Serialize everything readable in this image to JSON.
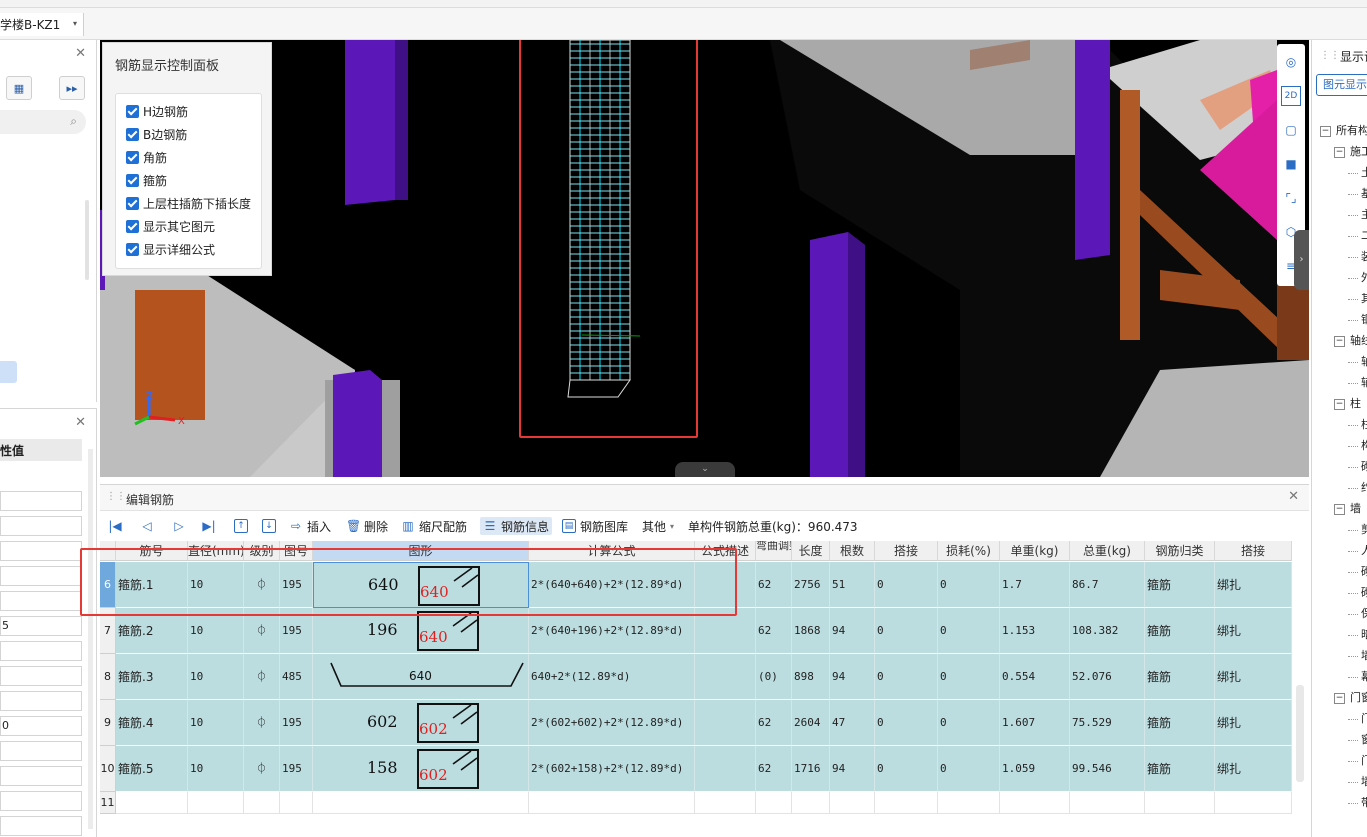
{
  "project": {
    "tab_label": "学楼B-KZ1",
    "dropdown": "▾"
  },
  "left": {
    "search_icon": "search-icon",
    "prop_header": "性值",
    "prop_values": [
      "",
      "",
      "",
      "",
      "",
      "5",
      "",
      "",
      "",
      "0",
      "",
      "",
      "",
      ""
    ]
  },
  "control_panel": {
    "title": "钢筋显示控制面板",
    "items": [
      "H边钢筋",
      "B边钢筋",
      "角筋",
      "箍筋",
      "上层柱插筋下插长度",
      "显示其它图元",
      "显示详细公式"
    ]
  },
  "view_toolbar": {
    "icons": [
      "orbit-icon",
      "2d-icon",
      "cube-icon",
      "cube-filled-icon",
      "fit-icon",
      "mesh-cube-icon",
      "list-icon"
    ],
    "labels": [
      "",
      "2D",
      "",
      "",
      "",
      "",
      ""
    ]
  },
  "right_panel": {
    "title": "显示设",
    "tab": "图元显示",
    "tree": [
      {
        "level": 0,
        "toggle": "−",
        "label": "所有构"
      },
      {
        "level": 1,
        "toggle": "−",
        "label": "施工"
      },
      {
        "level": 2,
        "toggle": "",
        "label": "土"
      },
      {
        "level": 2,
        "toggle": "",
        "label": "基"
      },
      {
        "level": 2,
        "toggle": "",
        "label": "主"
      },
      {
        "level": 2,
        "toggle": "",
        "label": "二"
      },
      {
        "level": 2,
        "toggle": "",
        "label": "装"
      },
      {
        "level": 2,
        "toggle": "",
        "label": "外"
      },
      {
        "level": 2,
        "toggle": "",
        "label": "其"
      },
      {
        "level": 2,
        "toggle": "",
        "label": "钢"
      },
      {
        "level": 1,
        "toggle": "−",
        "label": "轴线"
      },
      {
        "level": 2,
        "toggle": "",
        "label": "轴"
      },
      {
        "level": 2,
        "toggle": "",
        "label": "辅"
      },
      {
        "level": 1,
        "toggle": "−",
        "label": "柱"
      },
      {
        "level": 2,
        "toggle": "",
        "label": "柱"
      },
      {
        "level": 2,
        "toggle": "",
        "label": "构"
      },
      {
        "level": 2,
        "toggle": "",
        "label": "砌"
      },
      {
        "level": 2,
        "toggle": "",
        "label": "约"
      },
      {
        "level": 1,
        "toggle": "−",
        "label": "墙"
      },
      {
        "level": 2,
        "toggle": "",
        "label": "剪"
      },
      {
        "level": 2,
        "toggle": "",
        "label": "人"
      },
      {
        "level": 2,
        "toggle": "",
        "label": "砌"
      },
      {
        "level": 2,
        "toggle": "",
        "label": "砌"
      },
      {
        "level": 2,
        "toggle": "",
        "label": "保"
      },
      {
        "level": 2,
        "toggle": "",
        "label": "暗"
      },
      {
        "level": 2,
        "toggle": "",
        "label": "墙"
      },
      {
        "level": 2,
        "toggle": "",
        "label": "幕"
      },
      {
        "level": 1,
        "toggle": "−",
        "label": "门窗"
      },
      {
        "level": 2,
        "toggle": "",
        "label": "门"
      },
      {
        "level": 2,
        "toggle": "",
        "label": "窗"
      },
      {
        "level": 2,
        "toggle": "",
        "label": "门"
      },
      {
        "level": 2,
        "toggle": "",
        "label": "墙"
      },
      {
        "level": 2,
        "toggle": "",
        "label": "带"
      }
    ]
  },
  "edit_panel": {
    "title": "编辑钢筋",
    "toolbar": {
      "insert": "插入",
      "delete": "删除",
      "scale": "缩尺配筋",
      "info": "钢筋信息",
      "library": "钢筋图库",
      "other": "其他",
      "total_label": "单构件钢筋总重(kg)：960.473"
    },
    "columns": [
      "筋号",
      "直径(mm)",
      "级别",
      "图号",
      "图形",
      "计算公式",
      "公式描述",
      "弯曲调整",
      "长度",
      "根数",
      "搭接",
      "损耗(%)",
      "单重(kg)",
      "总重(kg)",
      "钢筋归类",
      "搭接"
    ],
    "rows": [
      {
        "num": "6",
        "name": "箍筋.1",
        "dia": "10",
        "grade": "⏀",
        "fig": "195",
        "shape_a": "640",
        "shape_b": "640",
        "formula": "2*(640+640)+2*(12.89*d)",
        "desc": "",
        "bend": "62",
        "len": "2756",
        "count": "51",
        "lap": "0",
        "loss": "0",
        "unit": "1.7",
        "total": "86.7",
        "cat": "箍筋",
        "lap2": "绑扎"
      },
      {
        "num": "7",
        "name": "箍筋.2",
        "dia": "10",
        "grade": "⏀",
        "fig": "195",
        "shape_a": "196",
        "shape_b": "640",
        "formula": "2*(640+196)+2*(12.89*d)",
        "desc": "",
        "bend": "62",
        "len": "1868",
        "count": "94",
        "lap": "0",
        "loss": "0",
        "unit": "1.153",
        "total": "108.382",
        "cat": "箍筋",
        "lap2": "绑扎"
      },
      {
        "num": "8",
        "name": "箍筋.3",
        "dia": "10",
        "grade": "⏀",
        "fig": "485",
        "shape_c": "640",
        "formula": "640+2*(12.89*d)",
        "desc": "",
        "bend": "(0)",
        "len": "898",
        "count": "94",
        "lap": "0",
        "loss": "0",
        "unit": "0.554",
        "total": "52.076",
        "cat": "箍筋",
        "lap2": "绑扎"
      },
      {
        "num": "9",
        "name": "箍筋.4",
        "dia": "10",
        "grade": "⏀",
        "fig": "195",
        "shape_a": "602",
        "shape_b": "602",
        "formula": "2*(602+602)+2*(12.89*d)",
        "desc": "",
        "bend": "62",
        "len": "2604",
        "count": "47",
        "lap": "0",
        "loss": "0",
        "unit": "1.607",
        "total": "75.529",
        "cat": "箍筋",
        "lap2": "绑扎"
      },
      {
        "num": "10",
        "name": "箍筋.5",
        "dia": "10",
        "grade": "⏀",
        "fig": "195",
        "shape_a": "158",
        "shape_b": "602",
        "formula": "2*(602+158)+2*(12.89*d)",
        "desc": "",
        "bend": "62",
        "len": "1716",
        "count": "94",
        "lap": "0",
        "loss": "0",
        "unit": "1.059",
        "total": "99.546",
        "cat": "箍筋",
        "lap2": "绑扎"
      }
    ],
    "empty_row_num": "11"
  },
  "colors": {
    "accent": "#2b6cc4",
    "row_bg": "#bcdde0",
    "highlight": "#e53935",
    "purple_column": "#5b17b8"
  }
}
